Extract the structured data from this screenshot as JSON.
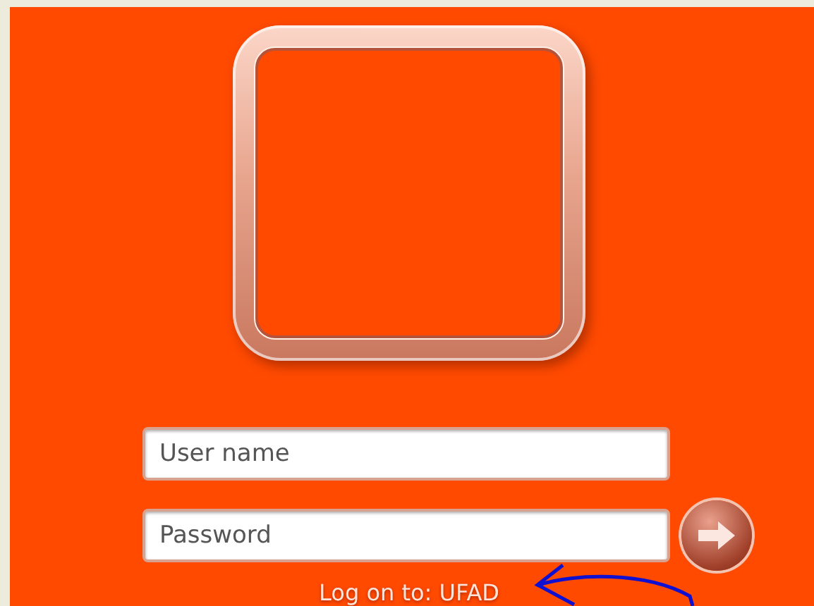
{
  "login": {
    "fields": [
      {
        "kind": "text",
        "placeholder": "User name"
      },
      {
        "kind": "password",
        "placeholder": "Password"
      }
    ],
    "logon_to": "Log on to: UFAD"
  }
}
